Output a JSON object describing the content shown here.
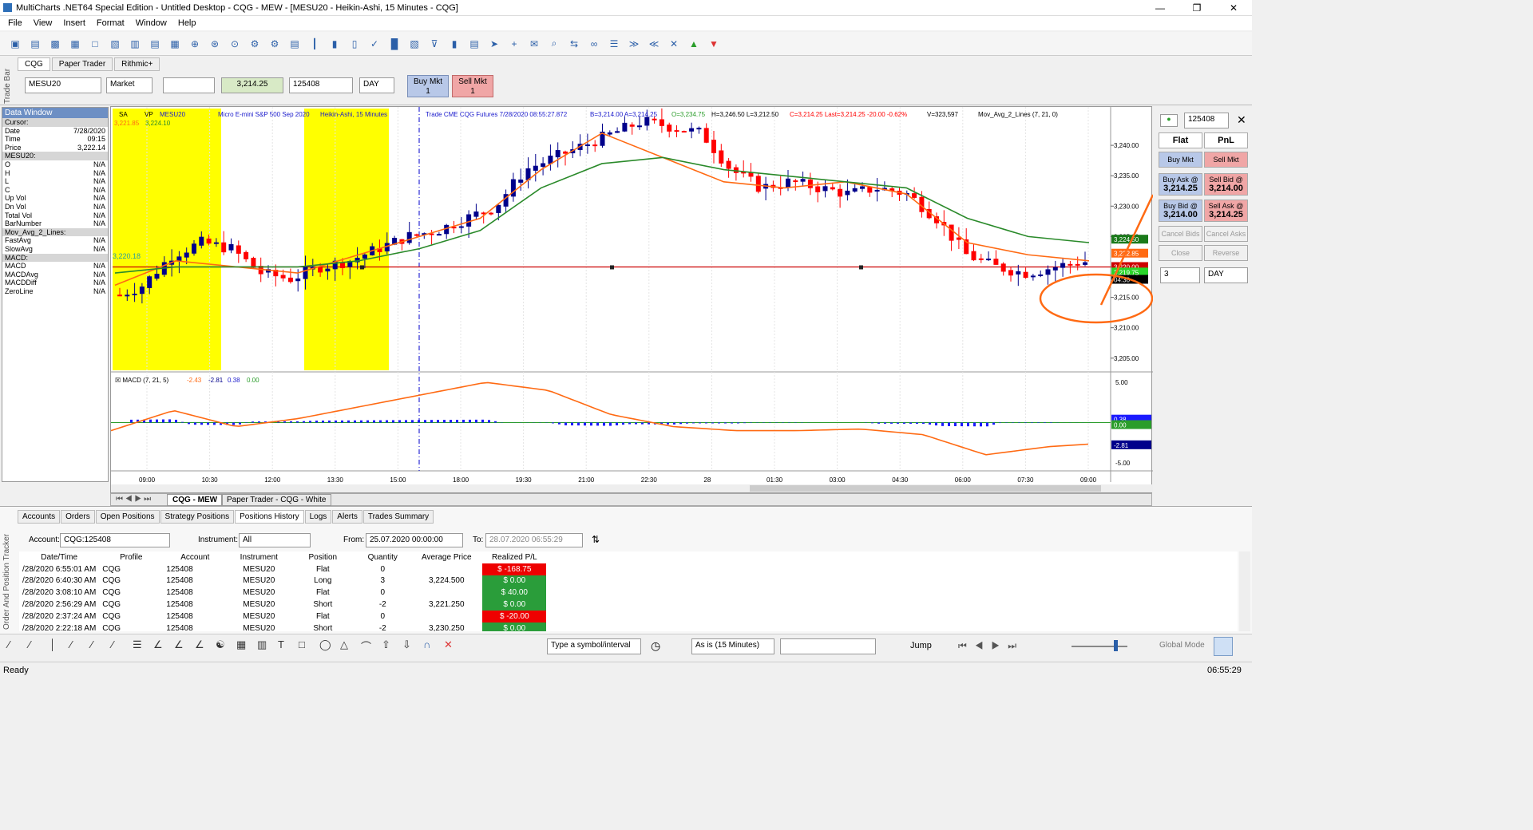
{
  "window": {
    "title": "MultiCharts .NET64 Special Edition - Untitled Desktop - CQG - MEW - [MESU20 - Heikin-Ashi, 15 Minutes - CQG]"
  },
  "menu": [
    "File",
    "View",
    "Insert",
    "Format",
    "Window",
    "Help"
  ],
  "tradebar": {
    "side_label": "Trade Bar",
    "tabs": [
      "CQG",
      "Paper Trader",
      "Rithmic+"
    ],
    "symbol": "MESU20",
    "order_type": "Market",
    "price": "3,214.25",
    "account": "125408",
    "tif": "DAY",
    "buy_label": "Buy Mkt",
    "buy_qty": "1",
    "sell_label": "Sell Mkt",
    "sell_qty": "1"
  },
  "data_window": {
    "title": "Data Window",
    "rows": [
      {
        "k": "Cursor:",
        "v": "",
        "grp": true
      },
      {
        "k": "Date",
        "v": "7/28/2020"
      },
      {
        "k": "Time",
        "v": "09:15"
      },
      {
        "k": "Price",
        "v": "3,222.14"
      },
      {
        "k": "MESU20:",
        "v": "",
        "grp": true
      },
      {
        "k": "O",
        "v": "N/A"
      },
      {
        "k": "H",
        "v": "N/A"
      },
      {
        "k": "L",
        "v": "N/A"
      },
      {
        "k": "C",
        "v": "N/A"
      },
      {
        "k": "Up Vol",
        "v": "N/A"
      },
      {
        "k": "Dn Vol",
        "v": "N/A"
      },
      {
        "k": "Total Vol",
        "v": "N/A"
      },
      {
        "k": "BarNumber",
        "v": "N/A"
      },
      {
        "k": "Mov_Avg_2_Lines:",
        "v": "",
        "grp": true
      },
      {
        "k": "FastAvg",
        "v": "N/A"
      },
      {
        "k": "SlowAvg",
        "v": "N/A"
      },
      {
        "k": "MACD:",
        "v": "",
        "grp": true
      },
      {
        "k": "MACD",
        "v": "N/A"
      },
      {
        "k": "MACDAvg",
        "v": "N/A"
      },
      {
        "k": "MACDDiff",
        "v": "N/A"
      },
      {
        "k": "ZeroLine",
        "v": "N/A"
      }
    ]
  },
  "chart": {
    "header": {
      "sa": "SA",
      "vp": "VP",
      "symbol": "MESU20",
      "desc": "Micro E-mini S&P 500 Sep 2020",
      "type": "Heikin-Ashi, 15 Minutes",
      "trade": "Trade CME CQG Futures 7/28/2020 08:55:27.872",
      "quote": "B=3,214.00 A=3,214.25",
      "ohlc1": "O=3,234.75",
      "ohlc2": "H=3,246.50 L=3,212.50",
      "ohlc3": "C=3,214.25 Last=3,214.25 -20.00 -0.62%",
      "vol": "V=323,597",
      "ind": "Mov_Avg_2_Lines (7, 21, 0)"
    },
    "small_vals": {
      "a": "3,221.85",
      "b": "3,224.10",
      "left_tag": "3,220.18"
    },
    "price_ticks": [
      "3,240.00",
      "3,235.00",
      "3,230.00",
      "3,225.00",
      "3,220.00",
      "3,215.00",
      "3,210.00",
      "3,205.00"
    ],
    "price_tags": {
      "green": "3,224.50",
      "orange": "3,222.85",
      "red": "3,220.00",
      "grn2": "3,219.75",
      "blk": "04:30"
    },
    "macd_header": "MACD (7, 21, 5)",
    "macd_vals": {
      "a": "-2.43",
      "b": "-2.81",
      "c": "0.38",
      "d": "0.00"
    },
    "macd_ticks": [
      "5.00",
      "0.00",
      "-5.00"
    ],
    "macd_tags": {
      "a": "0.38",
      "b": "0.00",
      "c": "-2.81"
    },
    "time_ticks": [
      "09:00",
      "10:30",
      "12:00",
      "13:30",
      "15:00",
      "18:00",
      "19:30",
      "21:00",
      "22:30",
      "28",
      "01:30",
      "03:00",
      "04:30",
      "06:00",
      "07:30",
      "09:00"
    ],
    "tabs": [
      "CQG - MEW",
      "Paper Trader - CQG - White"
    ]
  },
  "chart_data": {
    "type": "line",
    "title": "",
    "xlabel": "",
    "ylabel": "",
    "ylim": [
      3203,
      3245
    ],
    "series": [
      {
        "name": "FastAvg",
        "values": [
          3217,
          3221,
          3220,
          3219,
          3222,
          3225,
          3228,
          3236,
          3242,
          3238,
          3234,
          3233,
          3234,
          3232,
          3224,
          3222,
          3221
        ]
      },
      {
        "name": "SlowAvg",
        "values": [
          3219,
          3220,
          3220,
          3220,
          3221,
          3223,
          3226,
          3233,
          3237,
          3238,
          3236,
          3235,
          3234,
          3233,
          3228,
          3225,
          3224
        ]
      }
    ]
  },
  "right_panel": {
    "account": "125408",
    "flat": "Flat",
    "pnl": "PnL",
    "buy_mkt": "Buy Mkt",
    "sell_mkt": "Sell Mkt",
    "buy_ask": "Buy Ask @",
    "buy_ask_v": "3,214.25",
    "sell_bid": "Sell Bid @",
    "sell_bid_v": "3,214.00",
    "buy_bid": "Buy Bid @",
    "buy_bid_v": "3,214.00",
    "sell_ask": "Sell Ask @",
    "sell_ask_v": "3,214.25",
    "cancel_bids": "Cancel Bids",
    "cancel_asks": "Cancel Asks",
    "close": "Close",
    "reverse": "Reverse",
    "qty": "3",
    "tif": "DAY"
  },
  "tracker": {
    "side_label": "Order And Position Tracker",
    "tabs": [
      "Accounts",
      "Orders",
      "Open Positions",
      "Strategy Positions",
      "Positions History",
      "Logs",
      "Alerts",
      "Trades Summary"
    ],
    "account_label": "Account:",
    "account": "CQG:125408",
    "instrument_label": "Instrument:",
    "instrument": "All",
    "from_label": "From:",
    "from": "25.07.2020 00:00:00",
    "to_label": "To:",
    "to": "28.07.2020 06:55:29",
    "columns": [
      "Date/Time",
      "Profile",
      "Account",
      "Instrument",
      "Position",
      "Quantity",
      "Average Price",
      "Realized P/L"
    ],
    "rows": [
      [
        "/28/2020 6:55:01 AM",
        "CQG",
        "125408",
        "MESU20",
        "Flat",
        "0",
        "",
        "$ -168.75"
      ],
      [
        "/28/2020 6:40:30 AM",
        "CQG",
        "125408",
        "MESU20",
        "Long",
        "3",
        "3,224.500",
        "$ 0.00"
      ],
      [
        "/28/2020 3:08:10 AM",
        "CQG",
        "125408",
        "MESU20",
        "Flat",
        "0",
        "",
        "$ 40.00"
      ],
      [
        "/28/2020 2:56:29 AM",
        "CQG",
        "125408",
        "MESU20",
        "Short",
        "-2",
        "3,221.250",
        "$ 0.00"
      ],
      [
        "/28/2020 2:37:24 AM",
        "CQG",
        "125408",
        "MESU20",
        "Flat",
        "0",
        "",
        "$ -20.00"
      ],
      [
        "/28/2020 2:22:18 AM",
        "CQG",
        "125408",
        "MESU20",
        "Short",
        "-2",
        "3,230.250",
        "$ 0.00"
      ]
    ]
  },
  "drawbar": {
    "symbol_placeholder": "Type a symbol/interval",
    "as_is": "As is (15 Minutes)",
    "jump": "Jump",
    "global": "Global Mode"
  },
  "status": {
    "left": "Ready",
    "time": "06:55:29"
  }
}
